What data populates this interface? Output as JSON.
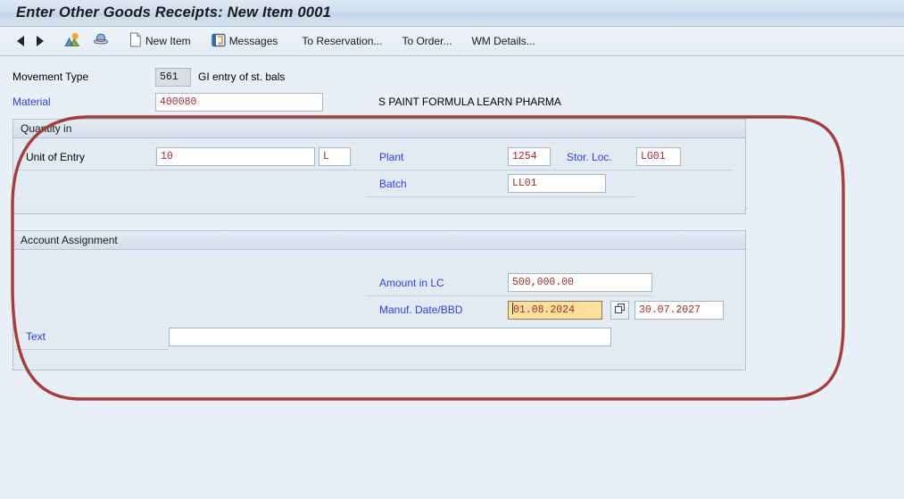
{
  "window": {
    "title": "Enter Other Goods Receipts: New Item 0001"
  },
  "toolbar": {
    "back_icon": "triangle-left-icon",
    "forward_icon": "triangle-right-icon",
    "landscape_icon": "landscape-picture-icon",
    "print_icon": "print-icon",
    "new_item_icon": "document-icon",
    "new_item_label": "New Item",
    "messages_icon": "messages-icon",
    "messages_label": "Messages",
    "to_reservation_label": "To Reservation...",
    "to_order_label": "To Order...",
    "wm_details_label": "WM Details..."
  },
  "form": {
    "movement_type": {
      "label": "Movement Type",
      "value": "561",
      "description": "GI entry of st. bals"
    },
    "material": {
      "label": "Material",
      "value": "400080",
      "description": "S PAINT FORMULA LEARN PHARMA"
    },
    "quantity_section": {
      "header": "Quantity in",
      "unit_of_entry": {
        "label": "Unit of Entry",
        "value": "10",
        "uom": "L"
      },
      "plant": {
        "label": "Plant",
        "value": "1254"
      },
      "stor_loc": {
        "label": "Stor. Loc.",
        "value": "LG01"
      },
      "batch": {
        "label": "Batch",
        "value": "LL01"
      }
    },
    "account_section": {
      "header": "Account Assignment",
      "amount_in_lc": {
        "label": "Amount in LC",
        "value": "500,000.00"
      },
      "manuf_date_bbd": {
        "label": "Manuf. Date/BBD",
        "value": "01.08.2024",
        "bbd_value": "30.07.2027",
        "picker_icon": "copy-overlap-icon",
        "focused": true
      },
      "text": {
        "label": "Text",
        "value": "",
        "placeholder": ""
      }
    }
  },
  "annotation": {
    "shape": "rounded-rectangle-highlight",
    "color": "#a83c3c"
  }
}
